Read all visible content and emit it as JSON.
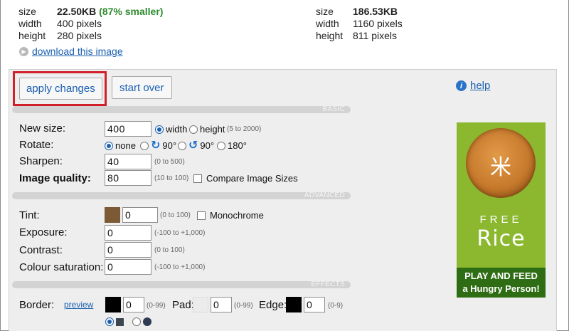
{
  "info_left": {
    "size_label": "size",
    "size_value": "22.50KB",
    "size_note": "(87% smaller)",
    "width_label": "width",
    "width_value": "400 pixels",
    "height_label": "height",
    "height_value": "280 pixels"
  },
  "info_right": {
    "size_label": "size",
    "size_value": "186.53KB",
    "width_label": "width",
    "width_value": "1160 pixels",
    "height_label": "height",
    "height_value": "811 pixels"
  },
  "download_label": "download this image",
  "toolbar": {
    "apply_label": "apply changes",
    "start_over_label": "start over",
    "help_label": "help"
  },
  "sections": {
    "basic": "BASIC",
    "advanced": "ADVANCED",
    "effects": "EFFECTS"
  },
  "basic": {
    "new_size_label": "New size:",
    "new_size_value": "400",
    "width_opt": "width",
    "height_opt": "height",
    "size_range": "(5 to 2000)",
    "rotate_label": "Rotate:",
    "rot_none": "none",
    "rot_90a": "90°",
    "rot_90b": "90°",
    "rot_180": "180°",
    "sharpen_label": "Sharpen:",
    "sharpen_value": "40",
    "sharpen_range": "(0 to 500)",
    "quality_label": "Image quality:",
    "quality_value": "80",
    "quality_range": "(10 to 100)",
    "compare_label": "Compare Image Sizes"
  },
  "advanced": {
    "tint_label": "Tint:",
    "tint_value": "0",
    "tint_range": "(0 to 100)",
    "monochrome_label": "Monochrome",
    "exposure_label": "Exposure:",
    "exposure_value": "0",
    "exposure_range": "(-100 to +1,000)",
    "contrast_label": "Contrast:",
    "contrast_value": "0",
    "contrast_range": "(0 to 100)",
    "saturation_label": "Colour saturation:",
    "saturation_value": "0",
    "saturation_range": "(-100 to +1,000)"
  },
  "effects": {
    "border_label": "Border:",
    "preview_label": "preview",
    "border_value": "0",
    "border_range": "(0-99)",
    "pad_label": "Pad:",
    "pad_value": "0",
    "pad_range": "(0-99)",
    "edge_label": "Edge:",
    "edge_value": "0",
    "edge_range": "(0-9)"
  },
  "ad": {
    "free": "FREE",
    "rice": "Rice",
    "slogan_1": "PLAY AND FEED",
    "slogan_2": "a Hungry Person!"
  },
  "colors": {
    "tint_swatch": "#7b5a35",
    "border_swatch": "#000000",
    "pad_swatch": "#eeeeee",
    "edge_swatch": "#000000",
    "highlight": "#d1202a",
    "link": "#1a5fb0"
  }
}
